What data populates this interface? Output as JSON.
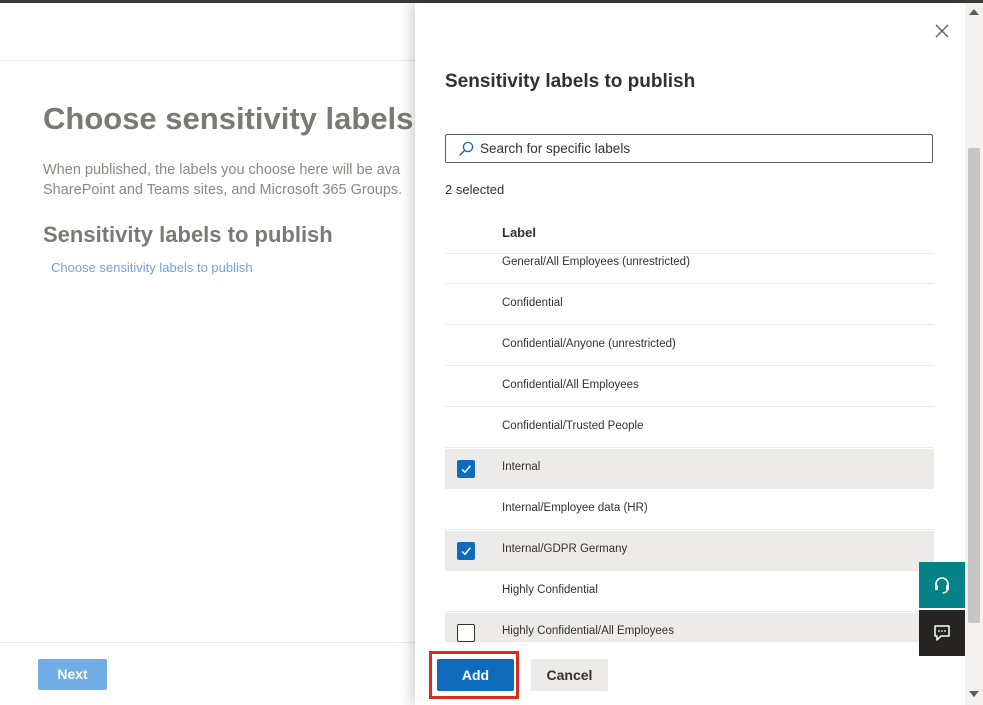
{
  "background_page": {
    "title": "Choose sensitivity labels t",
    "description_line1": "When published, the labels you choose here will be ava",
    "description_line2": "SharePoint and Teams sites, and Microsoft 365 Groups.",
    "subtitle": "Sensitivity labels to publish",
    "link": "Choose sensitivity labels to publish",
    "next_label": "Next"
  },
  "panel": {
    "title": "Sensitivity labels to publish",
    "search_placeholder": "Search for specific labels",
    "selected_count": "2 selected",
    "column_header": "Label",
    "rows": [
      {
        "label": "General/All Employees (unrestricted)",
        "selected": false,
        "show_checkbox": false
      },
      {
        "label": "Confidential",
        "selected": false,
        "show_checkbox": false
      },
      {
        "label": "Confidential/Anyone (unrestricted)",
        "selected": false,
        "show_checkbox": false
      },
      {
        "label": "Confidential/All Employees",
        "selected": false,
        "show_checkbox": false
      },
      {
        "label": "Confidential/Trusted People",
        "selected": false,
        "show_checkbox": false
      },
      {
        "label": "Internal",
        "selected": true,
        "show_checkbox": true
      },
      {
        "label": "Internal/Employee data (HR)",
        "selected": false,
        "show_checkbox": false
      },
      {
        "label": "Internal/GDPR Germany",
        "selected": true,
        "show_checkbox": true
      },
      {
        "label": "Highly Confidential",
        "selected": false,
        "show_checkbox": false
      },
      {
        "label": "Highly Confidential/All Employees",
        "selected": false,
        "show_checkbox": true
      }
    ],
    "add_label": "Add",
    "cancel_label": "Cancel"
  },
  "icons": {
    "close": "close-icon",
    "search": "search-icon",
    "checkmark": "checkmark-icon",
    "help": "headset-icon",
    "feedback": "feedback-icon"
  },
  "colors": {
    "accent": "#0f6cbd",
    "highlight_border": "#d92b1f",
    "help_button": "#038387",
    "feedback_button": "#252423"
  }
}
